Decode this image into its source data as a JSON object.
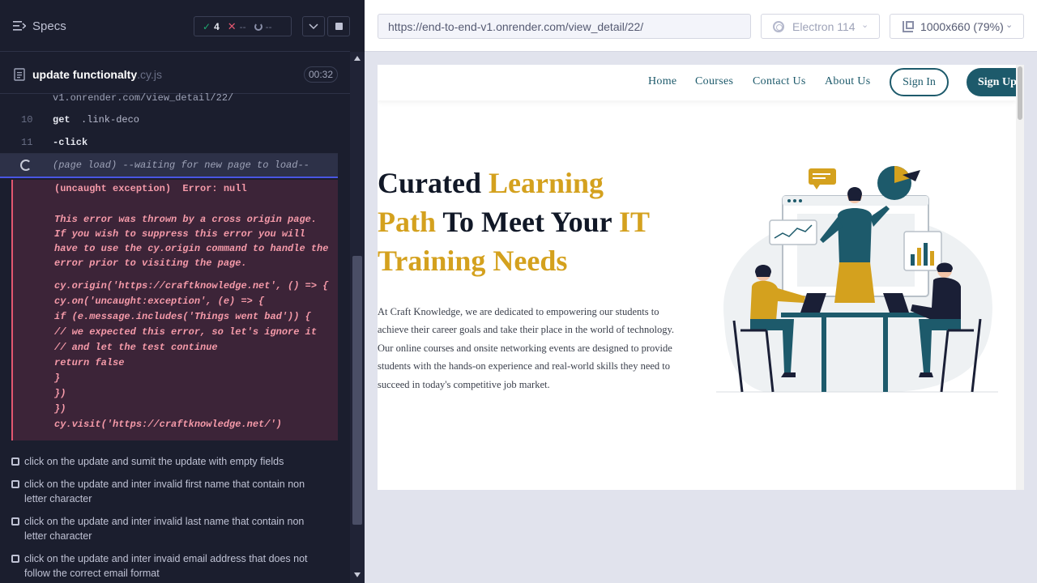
{
  "runner": {
    "specs_label": "Specs",
    "stats": {
      "passed": "4",
      "failed": "--",
      "pending": "--"
    },
    "spec": {
      "name": "update functionalty",
      "ext": ".cy.js",
      "time": "00:32"
    },
    "commands": {
      "url_tail": "v1.onrender.com/view_detail/22/",
      "c10": {
        "num": "10",
        "name": "get",
        "arg": ".link-deco"
      },
      "c11": {
        "num": "11",
        "name": "-click"
      },
      "pageload": "(page load)  --waiting for new page to load--"
    },
    "error": {
      "title": "(uncaught exception)  Error: null",
      "message": "This error was thrown by a cross origin page. If you wish to suppress this error you will have to use the cy.origin command to handle the error prior to visiting the page.",
      "code": [
        "cy.origin('https://craftknowledge.net', () => {",
        "cy.on('uncaught:exception', (e) => {",
        "if (e.message.includes('Things went bad')) {",
        "// we expected this error, so let's ignore it",
        "// and let the test continue",
        "return false",
        "}",
        "})",
        "})",
        "cy.visit('https://craftknowledge.net/')"
      ]
    },
    "tests": [
      "click on the update and sumit the update with empty fields",
      "click on the update and inter invalid first name that contain non letter character",
      "click on the update and inter invalid last name that contain non letter character",
      "click on the update and inter invaid email address that does not follow the correct email format"
    ]
  },
  "aut": {
    "url": "https://end-to-end-v1.onrender.com/view_detail/22/",
    "browser": "Electron 114",
    "viewport": "1000x660  (79%)"
  },
  "site": {
    "nav": {
      "home": "Home",
      "courses": "Courses",
      "contact": "Contact Us",
      "about": "About Us",
      "signin": "Sign In",
      "signup": "Sign Up"
    },
    "hero": {
      "t1": "Curated ",
      "t1_accent": "Learning",
      "t2_accent": "Path",
      "t2": " To Meet Your ",
      "t2_accent2": "IT",
      "t3_accent": "Training Needs",
      "description": "At Craft Knowledge, we are dedicated to empowering our students to achieve their career goals and take their place in the world of technology. Our online courses and onsite networking events are designed to provide students with the hands-on experience and real-world skills they need to succeed in today's competitive job market."
    }
  },
  "colors": {
    "runner_bg": "#1b1e2e",
    "error_bg": "#3c2438",
    "error_text": "#f59aa9",
    "site_primary": "#1d5a6b",
    "site_accent": "#d4a11e"
  }
}
